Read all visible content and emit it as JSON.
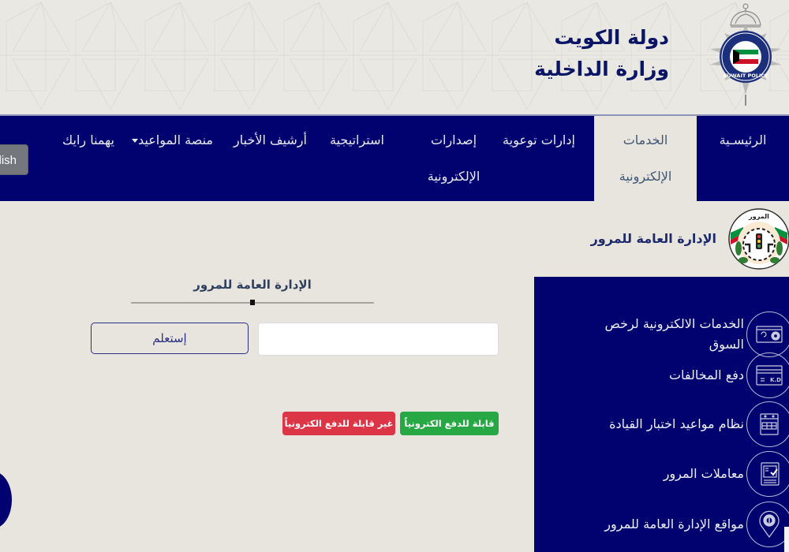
{
  "header": {
    "title_line1": "دولة الكويت",
    "title_line2": "وزارة الداخلية",
    "logo": "kuwait-police-emblem",
    "logo_text": "KUWAIT POLICE"
  },
  "nav": {
    "items": [
      {
        "label": "الرئيسـية",
        "active": false
      },
      {
        "label_line1": "الخدمات",
        "label_line2": "الإلكترونية",
        "active": true
      },
      {
        "label": "إدارات توعوية",
        "active": false
      },
      {
        "label_line1": "إصدارات",
        "label_line2": "الإلكترونية",
        "active": false
      },
      {
        "label": "استراتيجية",
        "active": false
      },
      {
        "label": "أرشيف الأخبار",
        "active": false
      },
      {
        "label": "منصة المواعيد",
        "has_dropdown": true,
        "active": false
      },
      {
        "label": "يهمنا رايك",
        "active": false
      }
    ],
    "language_button": "English",
    "language_button_visible": "lish",
    "colors": {
      "nav_bg": "#01016f",
      "active_bg": "#e8e5df"
    }
  },
  "department": {
    "title": "الإدارة العامة للمرور",
    "logo": "traffic-department-emblem"
  },
  "search": {
    "title": "الإدارة العامة للمرور",
    "input_value": "",
    "input_placeholder": "",
    "button_label": "إستعلم"
  },
  "legend": {
    "payable": {
      "label": "قابلة للدفع الكترونياً",
      "color": "#28a745"
    },
    "not_payable": {
      "label": "غير قابلة للدفع الكترونياً",
      "color": "#dc3545"
    }
  },
  "services": {
    "items": [
      {
        "label": "الخدمات الالكترونية لرخص السوق",
        "icon": "license-card-icon"
      },
      {
        "label": "دفع المخالفات",
        "icon": "kd-card-icon",
        "icon_text": "K.D"
      },
      {
        "label": "نظام مواعيد اختبار القيادة",
        "icon": "calendar-icon"
      },
      {
        "label": "معاملات المرور",
        "icon": "clipboard-check-icon"
      },
      {
        "label": "مواقع الإدارة العامة للمرور",
        "icon": "location-pin-icon"
      }
    ]
  }
}
